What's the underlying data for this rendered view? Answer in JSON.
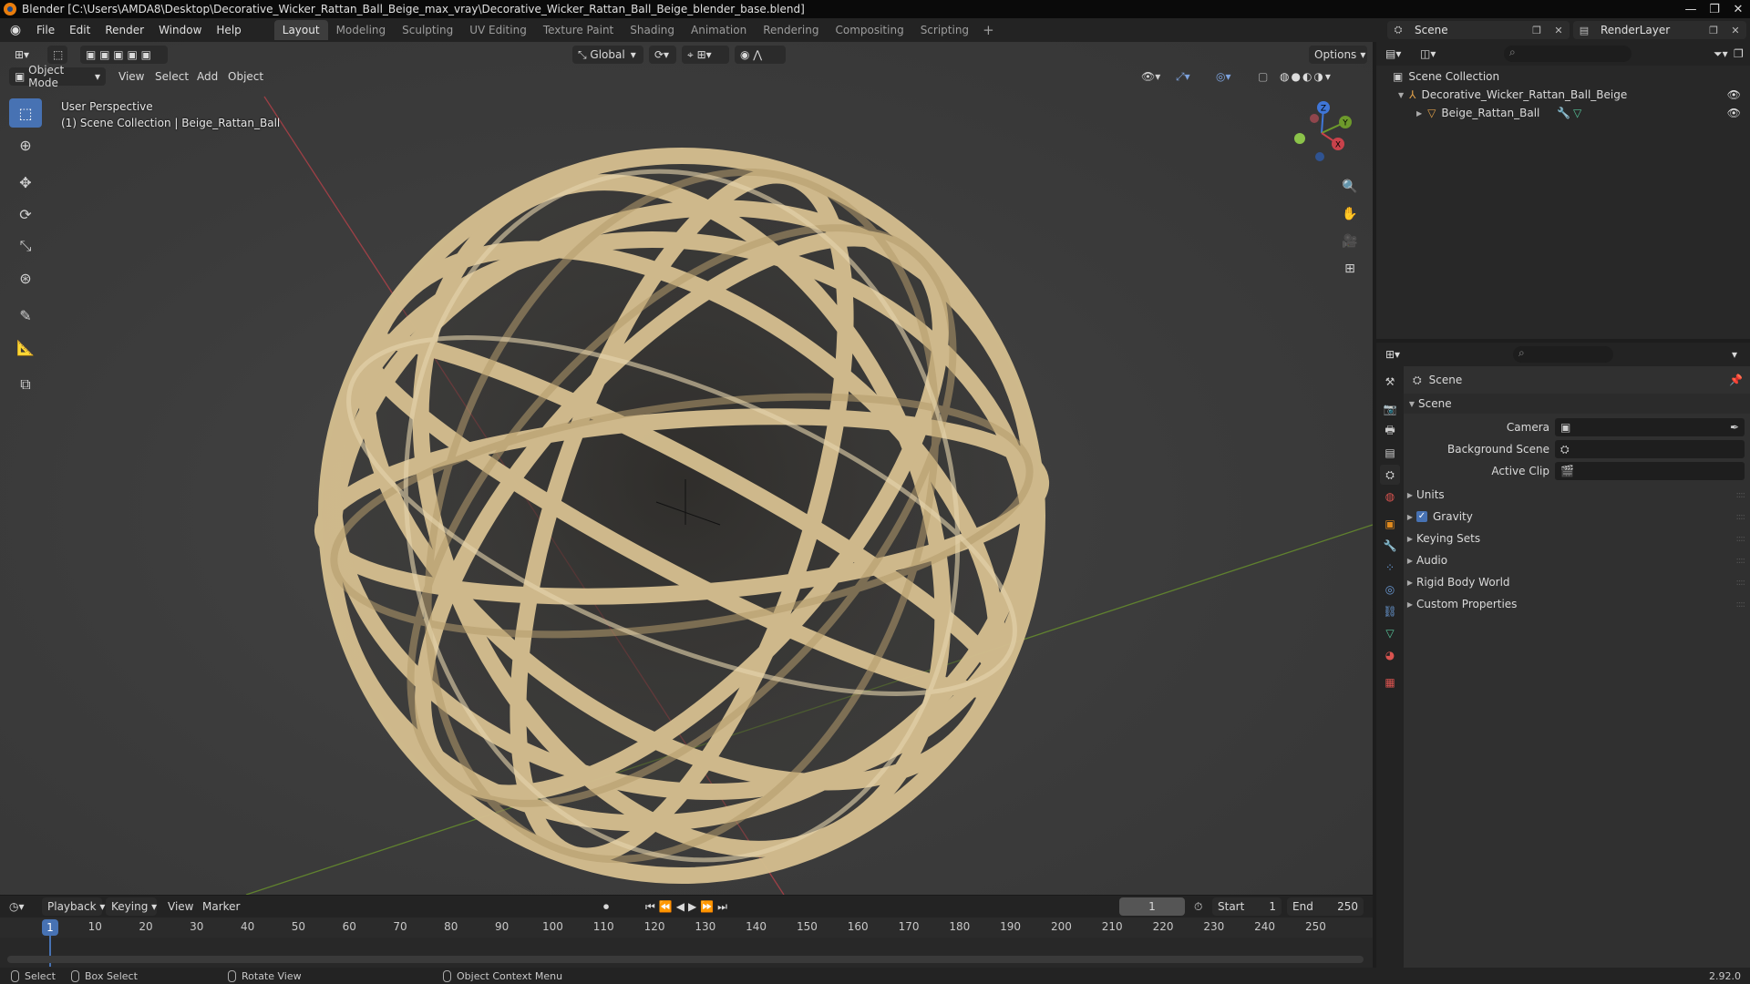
{
  "window": {
    "title": "Blender [C:\\Users\\AMDA8\\Desktop\\Decorative_Wicker_Rattan_Ball_Beige_max_vray\\Decorative_Wicker_Rattan_Ball_Beige_blender_base.blend]",
    "minimize": "—",
    "maximize": "❐",
    "close": "✕"
  },
  "menu": {
    "file": "File",
    "edit": "Edit",
    "render": "Render",
    "window": "Window",
    "help": "Help"
  },
  "workspaces": [
    "Layout",
    "Modeling",
    "Sculpting",
    "UV Editing",
    "Texture Paint",
    "Shading",
    "Animation",
    "Rendering",
    "Compositing",
    "Scripting"
  ],
  "workspace_active": "Layout",
  "scene_selector": {
    "value": "Scene"
  },
  "layer_selector": {
    "value": "RenderLayer"
  },
  "viewport": {
    "mode": "Object Mode",
    "view_menu": "View",
    "select_menu": "Select",
    "add_menu": "Add",
    "object_menu": "Object",
    "transform_orientation": "Global",
    "options": "Options",
    "overlay_line1": "User Perspective",
    "overlay_line2": "(1) Scene Collection | Beige_Rattan_Ball",
    "gizmo_labels": {
      "x": "X",
      "y": "Y",
      "z": "Z"
    }
  },
  "timeline": {
    "playback": "Playback",
    "keying": "Keying",
    "view": "View",
    "marker": "Marker",
    "current_frame": "1",
    "start_label": "Start",
    "start_value": "1",
    "end_label": "End",
    "end_value": "250",
    "ticks": [
      "1",
      "10",
      "20",
      "30",
      "40",
      "50",
      "60",
      "70",
      "80",
      "90",
      "100",
      "110",
      "120",
      "130",
      "140",
      "150",
      "160",
      "170",
      "180",
      "190",
      "200",
      "210",
      "220",
      "230",
      "240",
      "250"
    ]
  },
  "statusbar": {
    "select": "Select",
    "box_select": "Box Select",
    "rotate_view": "Rotate View",
    "context_menu": "Object Context Menu",
    "version": "2.92.0"
  },
  "outliner": {
    "root": "Scene Collection",
    "collection": "Decorative_Wicker_Rattan_Ball_Beige",
    "object": "Beige_Rattan_Ball"
  },
  "properties": {
    "context": "Scene",
    "panel": "Scene",
    "camera_label": "Camera",
    "background_label": "Background Scene",
    "clip_label": "Active Clip",
    "subpanels": [
      "Units",
      "Gravity",
      "Keying Sets",
      "Audio",
      "Rigid Body World",
      "Custom Properties"
    ],
    "gravity_checked": true
  },
  "colors": {
    "accent": "#4772b3",
    "rattan": "#d8c49a",
    "axis_x": "#c8424b",
    "axis_y": "#6d9a2b"
  }
}
